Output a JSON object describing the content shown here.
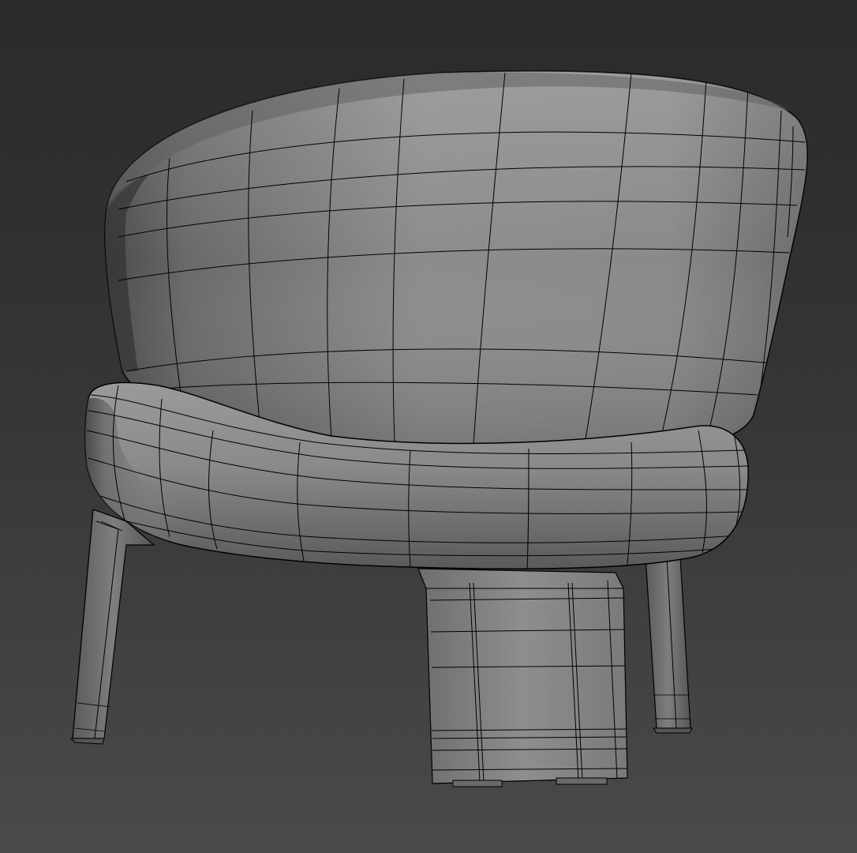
{
  "viewport": {
    "background_top": "#2a2a2a",
    "background_bottom": "#4a4a4a",
    "wire_color": "#000000",
    "shade_light": "#9a9a9a",
    "shade_mid": "#7a7a7a",
    "shade_dark": "#3e3e3e"
  },
  "model": {
    "object": "lounge-chair-wireframe",
    "parts": [
      "backrest",
      "seat-ring",
      "front-left-leg",
      "front-right-leg",
      "center-leg"
    ]
  }
}
